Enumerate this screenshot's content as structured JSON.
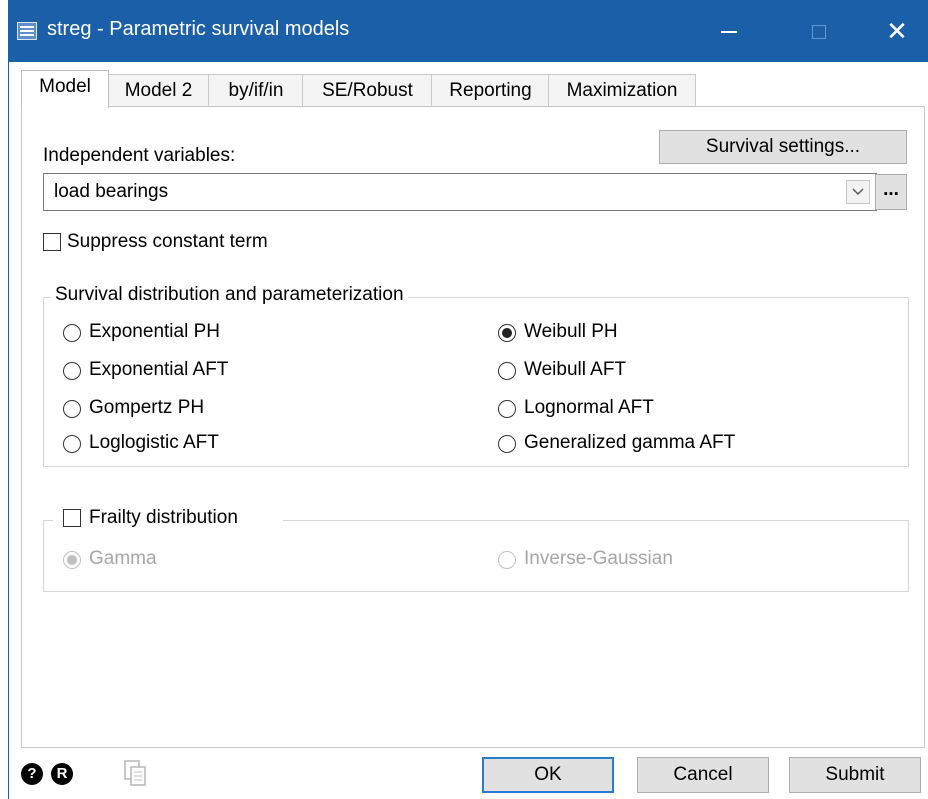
{
  "window": {
    "title": "streg - Parametric survival models",
    "titlebar_color": "#1b5fa8",
    "controls": {
      "minimize": "minimize-icon",
      "maximize": "maximize-icon",
      "close": "close-icon"
    }
  },
  "tabs": [
    {
      "label": "Model",
      "active": true
    },
    {
      "label": "Model 2",
      "active": false
    },
    {
      "label": "by/if/in",
      "active": false
    },
    {
      "label": "SE/Robust",
      "active": false
    },
    {
      "label": "Reporting",
      "active": false
    },
    {
      "label": "Maximization",
      "active": false
    }
  ],
  "model": {
    "survival_settings_label": "Survival settings...",
    "indep_vars_label": "Independent variables:",
    "indep_vars_value": "load bearings",
    "browse_label": "...",
    "suppress_constant_label": "Suppress constant term",
    "suppress_constant_checked": false,
    "distribution_group_label": "Survival distribution and parameterization",
    "distributions": [
      {
        "label": "Exponential PH",
        "selected": false
      },
      {
        "label": "Exponential AFT",
        "selected": false
      },
      {
        "label": "Gompertz PH",
        "selected": false
      },
      {
        "label": "Loglogistic AFT",
        "selected": false
      },
      {
        "label": "Weibull PH",
        "selected": true
      },
      {
        "label": "Weibull AFT",
        "selected": false
      },
      {
        "label": "Lognormal AFT",
        "selected": false
      },
      {
        "label": "Generalized gamma AFT",
        "selected": false
      }
    ],
    "frailty_label": "Frailty distribution",
    "frailty_checked": false,
    "frailty_options": [
      {
        "label": "Gamma",
        "selected": true,
        "enabled": false
      },
      {
        "label": "Inverse-Gaussian",
        "selected": false,
        "enabled": false
      }
    ]
  },
  "footer": {
    "help_icon": "?",
    "reset_icon": "R",
    "copy_icon": "copy-icon",
    "ok_label": "OK",
    "cancel_label": "Cancel",
    "submit_label": "Submit"
  }
}
